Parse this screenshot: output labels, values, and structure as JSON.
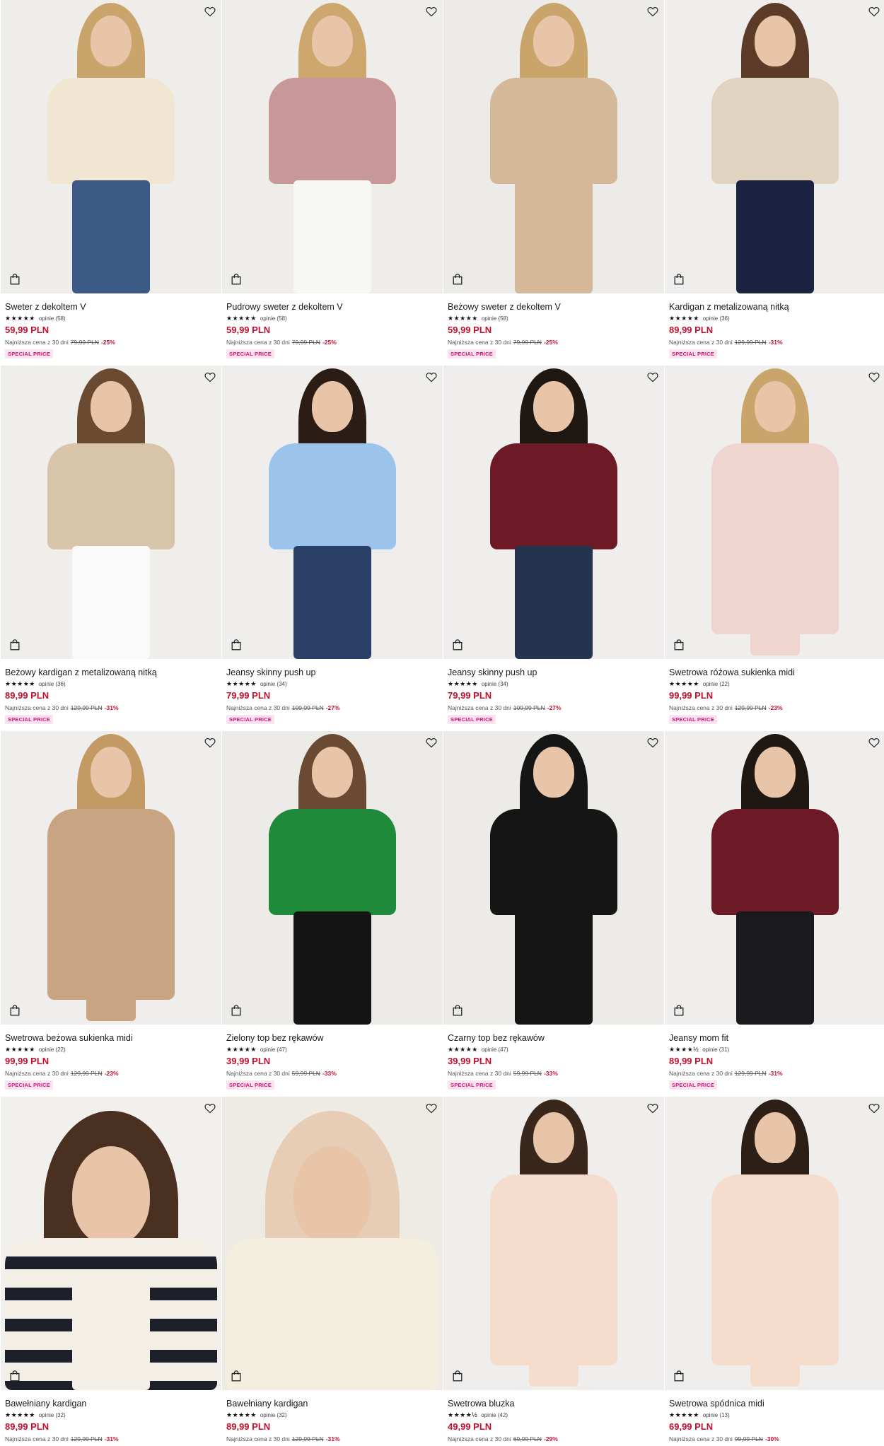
{
  "products": [
    {
      "name": "Sweter z dekoltem V",
      "stars": "★★★★★",
      "reviews": "opinie (58)",
      "price": "59,99 PLN",
      "lowest_label": "Najniższa cena z 30 dni",
      "old_price": "79,99 PLN",
      "discount": "-25%",
      "badge": "SPECIAL PRICE",
      "wishlist_icon": "heart-outline-icon",
      "bag_icon": "shopping-bag-icon",
      "colors": {
        "bg": "#eeede9",
        "top": "#f1e6d2",
        "bottom": "#3d5a86",
        "hair": "#c9a46b"
      }
    },
    {
      "name": "Pudrowy sweter z dekoltem V",
      "stars": "★★★★★",
      "reviews": "opinie (58)",
      "price": "59,99 PLN",
      "lowest_label": "Najniższa cena z 30 dni",
      "old_price": "79,99 PLN",
      "discount": "-25%",
      "badge": "SPECIAL PRICE",
      "wishlist_icon": "heart-outline-icon",
      "bag_icon": "shopping-bag-icon",
      "colors": {
        "bg": "#eeedea",
        "top": "#c8979a",
        "bottom": "#f7f7f5",
        "hair": "#cda76d"
      }
    },
    {
      "name": "Beżowy sweter z dekoltem V",
      "stars": "★★★★★",
      "reviews": "opinie (58)",
      "price": "59,99 PLN",
      "lowest_label": "Najniższa cena z 30 dni",
      "old_price": "79,99 PLN",
      "discount": "-25%",
      "badge": "SPECIAL PRICE",
      "wishlist_icon": "heart-outline-icon",
      "bag_icon": "shopping-bag-icon",
      "colors": {
        "bg": "#ecebe8",
        "top": "#d5b89a",
        "bottom": "#d5b89a",
        "hair": "#c9a46b"
      }
    },
    {
      "name": "Kardigan z metalizowaną nitką",
      "stars": "★★★★★",
      "reviews": "opinie (36)",
      "price": "89,99 PLN",
      "lowest_label": "Najniższa cena z 30 dni",
      "old_price": "129,99 PLN",
      "discount": "-31%",
      "badge": "SPECIAL PRICE",
      "wishlist_icon": "heart-outline-icon",
      "bag_icon": "shopping-bag-icon",
      "colors": {
        "bg": "#efeeec",
        "top": "#e0d3c0",
        "bottom": "#1c2340",
        "hair": "#5b3b28"
      }
    },
    {
      "name": "Beżowy kardigan z metalizowaną nitką",
      "stars": "★★★★★",
      "reviews": "opinie (36)",
      "price": "89,99 PLN",
      "lowest_label": "Najniższa cena z 30 dni",
      "old_price": "129,99 PLN",
      "discount": "-31%",
      "badge": "SPECIAL PRICE",
      "wishlist_icon": "heart-outline-icon",
      "bag_icon": "shopping-bag-icon",
      "colors": {
        "bg": "#efeeeb",
        "top": "#d8c4a8",
        "bottom": "#fafafa",
        "hair": "#6b4a32"
      }
    },
    {
      "name": "Jeansy skinny push up",
      "stars": "★★★★★",
      "reviews": "opinie (34)",
      "price": "79,99 PLN",
      "lowest_label": "Najniższa cena z 30 dni",
      "old_price": "109,99 PLN",
      "discount": "-27%",
      "badge": "SPECIAL PRICE",
      "wishlist_icon": "heart-outline-icon",
      "bag_icon": "shopping-bag-icon",
      "colors": {
        "bg": "#efeeec",
        "top": "#9cc3ec",
        "bottom": "#2a3f66",
        "hair": "#2b1d16"
      }
    },
    {
      "name": "Jeansy skinny push up",
      "stars": "★★★★★",
      "reviews": "opinie (34)",
      "price": "79,99 PLN",
      "lowest_label": "Najniższa cena z 30 dni",
      "old_price": "109,99 PLN",
      "discount": "-27%",
      "badge": "SPECIAL PRICE",
      "wishlist_icon": "heart-outline-icon",
      "bag_icon": "shopping-bag-icon",
      "colors": {
        "bg": "#efeeec",
        "top": "#6e1a26",
        "bottom": "#24344f",
        "hair": "#1f1712"
      }
    },
    {
      "name": "Swetrowa różowa sukienka midi",
      "stars": "★★★★★",
      "reviews": "opinie (22)",
      "price": "99,99 PLN",
      "lowest_label": "Najniższa cena z 30 dni",
      "old_price": "129,99 PLN",
      "discount": "-23%",
      "badge": "SPECIAL PRICE",
      "wishlist_icon": "heart-outline-icon",
      "bag_icon": "shopping-bag-icon",
      "colors": {
        "bg": "#efeeec",
        "top": "#f0d4cf",
        "bottom": "#f0d4cf",
        "hair": "#c9a46b"
      }
    },
    {
      "name": "Swetrowa beżowa sukienka midi",
      "stars": "★★★★★",
      "reviews": "opinie (22)",
      "price": "99,99 PLN",
      "lowest_label": "Najniższa cena z 30 dni",
      "old_price": "129,99 PLN",
      "discount": "-23%",
      "badge": "SPECIAL PRICE",
      "wishlist_icon": "heart-outline-icon",
      "bag_icon": "shopping-bag-icon",
      "colors": {
        "bg": "#efeeec",
        "top": "#c8a482",
        "bottom": "#c8a482",
        "hair": "#c39a63"
      }
    },
    {
      "name": "Zielony top bez rękawów",
      "stars": "★★★★★",
      "reviews": "opinie (47)",
      "price": "39,99 PLN",
      "lowest_label": "Najniższa cena z 30 dni",
      "old_price": "59,99 PLN",
      "discount": "-33%",
      "badge": "SPECIAL PRICE",
      "wishlist_icon": "heart-outline-icon",
      "bag_icon": "shopping-bag-icon",
      "colors": {
        "bg": "#ecebe8",
        "top": "#1e8a3a",
        "bottom": "#141414",
        "hair": "#6b4a33"
      }
    },
    {
      "name": "Czarny top bez rękawów",
      "stars": "★★★★★",
      "reviews": "opinie (47)",
      "price": "39,99 PLN",
      "lowest_label": "Najniższa cena z 30 dni",
      "old_price": "59,99 PLN",
      "discount": "-33%",
      "badge": "SPECIAL PRICE",
      "wishlist_icon": "heart-outline-icon",
      "bag_icon": "shopping-bag-icon",
      "colors": {
        "bg": "#ecebe8",
        "top": "#151515",
        "bottom": "#151515",
        "hair": "#151515"
      }
    },
    {
      "name": "Jeansy mom fit",
      "stars": "★★★★½",
      "reviews": "opinie (31)",
      "price": "89,99 PLN",
      "lowest_label": "Najniższa cena z 30 dni",
      "old_price": "129,99 PLN",
      "discount": "-31%",
      "badge": "SPECIAL PRICE",
      "wishlist_icon": "heart-outline-icon",
      "bag_icon": "shopping-bag-icon",
      "colors": {
        "bg": "#efeeec",
        "top": "#6e1a26",
        "bottom": "#1a1a1e",
        "hair": "#1f1712"
      }
    },
    {
      "name": "Bawełniany kardigan",
      "stars": "★★★★★",
      "reviews": "opinie (32)",
      "price": "89,99 PLN",
      "lowest_label": "Najniższa cena z 30 dni",
      "old_price": "129,99 PLN",
      "discount": "-31%",
      "badge": "",
      "wishlist_icon": "heart-outline-icon",
      "bag_icon": "shopping-bag-icon",
      "colors": {
        "bg": "#f2f0ec",
        "top": "stripes",
        "bottom": "#f3efe6",
        "hair": "#4a3020"
      }
    },
    {
      "name": "Bawełniany kardigan",
      "stars": "★★★★★",
      "reviews": "opinie (32)",
      "price": "89,99 PLN",
      "lowest_label": "Najniższa cena z 30 dni",
      "old_price": "129,99 PLN",
      "discount": "-31%",
      "badge": "",
      "wishlist_icon": "heart-outline-icon",
      "bag_icon": "shopping-bag-icon",
      "colors": {
        "bg": "#eeebe4",
        "top": "#f3eedd",
        "bottom": "#f3eedd",
        "hair": "#e7cdb5"
      }
    },
    {
      "name": "Swetrowa bluzka",
      "stars": "★★★★½",
      "reviews": "opinie (42)",
      "price": "49,99 PLN",
      "lowest_label": "Najniższa cena z 30 dni",
      "old_price": "69,99 PLN",
      "discount": "-29%",
      "badge": "",
      "wishlist_icon": "heart-outline-icon",
      "bag_icon": "shopping-bag-icon",
      "colors": {
        "bg": "#efeeec",
        "top": "#f6dccc",
        "bottom": "#f6dccc",
        "hair": "#3a271c"
      }
    },
    {
      "name": "Swetrowa spódnica midi",
      "stars": "★★★★★",
      "reviews": "opinie (13)",
      "price": "69,99 PLN",
      "lowest_label": "Najniższa cena z 30 dni",
      "old_price": "99,99 PLN",
      "discount": "-30%",
      "badge": "",
      "wishlist_icon": "heart-outline-icon",
      "bag_icon": "shopping-bag-icon",
      "colors": {
        "bg": "#efeeec",
        "top": "#f6dccc",
        "bottom": "#f6dccc",
        "hair": "#2e1f16"
      }
    }
  ]
}
